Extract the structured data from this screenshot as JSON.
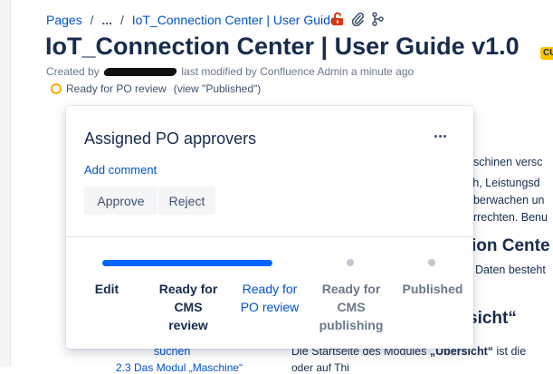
{
  "breadcrumb": {
    "pages": "Pages",
    "sep1": "/",
    "ellipsis": "...",
    "sep2": "/",
    "current": "IoT_Connection Center | User Guide",
    "icons": [
      "lock-open-icon",
      "attachment-icon",
      "share-tree-icon"
    ]
  },
  "page": {
    "title": "IoT_Connection Center | User Guide v1.0",
    "meta_prefix": "Created by",
    "meta_suffix": "last modified by Confluence Admin a minute ago",
    "status": "Ready for PO review",
    "view": "(view \"Published\")",
    "lozenge": "CU"
  },
  "background": {
    "lines": [
      "aschinen versc",
      "ch, Leistungsd",
      "überwachen un",
      "errechten. Benu"
    ],
    "heading1": "ion Cente",
    "line5": "Daten besteht",
    "heading2": "sicht“",
    "bottom_left": "suchen",
    "bottom_right_prefix": "Die Startseite des Modules ",
    "bottom_right_bold": "„Übersicht“",
    "bottom_right_suffix": " ist die",
    "bottom_cut_left": "2.3 Das Modul „Maschine“",
    "bottom_cut_right": "oder auf Thi"
  },
  "popover": {
    "title": "Assigned PO approvers",
    "add_comment": "Add comment",
    "approve": "Approve",
    "reject": "Reject",
    "stages": [
      {
        "label": "Edit",
        "state": "done"
      },
      {
        "label": "Ready for\nCMS\nreview",
        "state": "done"
      },
      {
        "label": "Ready for\nPO review",
        "state": "current"
      },
      {
        "label": "Ready for\nCMS\npublishing",
        "state": "future"
      },
      {
        "label": "Published",
        "state": "future"
      }
    ]
  },
  "colors": {
    "link": "#0052cc",
    "progress": "#0065ff",
    "status_dot": "#ffab00",
    "lozenge": "#ffc400"
  }
}
